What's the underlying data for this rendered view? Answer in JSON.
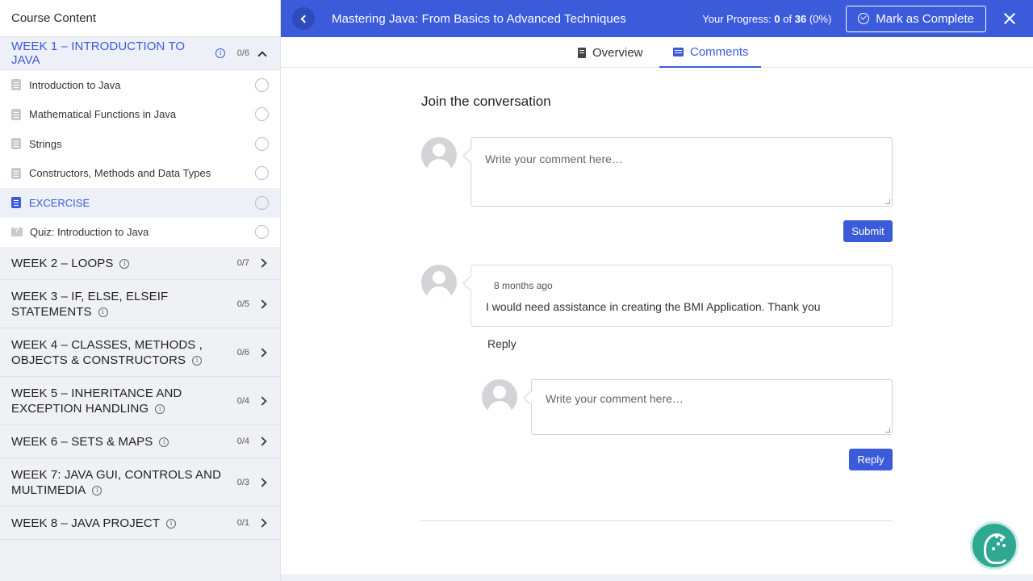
{
  "sidebar": {
    "header": "Course Content",
    "open_week": {
      "title": "WEEK 1 – INTRODUCTION TO JAVA",
      "count": "0/6",
      "lessons": [
        {
          "label": "Introduction to Java",
          "icon": "document-icon"
        },
        {
          "label": "Mathematical Functions in Java",
          "icon": "document-icon"
        },
        {
          "label": "Strings",
          "icon": "document-icon"
        },
        {
          "label": "Constructors, Methods and Data Types",
          "icon": "document-icon"
        },
        {
          "label": "EXCERCISE",
          "icon": "document-icon",
          "active": true
        },
        {
          "label": "Quiz: Introduction to Java",
          "icon": "quiz-icon"
        }
      ]
    },
    "weeks": [
      {
        "title_line1": "WEEK 2 – LOOPS",
        "title_line2": "",
        "count": "0/7"
      },
      {
        "title_line1": "WEEK 3 – IF, ELSE, ELSEIF",
        "title_line2": "STATEMENTS",
        "count": "0/5"
      },
      {
        "title_line1": "WEEK 4 – CLASSES, METHODS ,",
        "title_line2": "OBJECTS & CONSTRUCTORS",
        "count": "0/6"
      },
      {
        "title_line1": "WEEK 5 – INHERITANCE AND",
        "title_line2": "EXCEPTION HANDLING",
        "count": "0/4"
      },
      {
        "title_line1": "WEEK 6 – SETS & MAPS",
        "title_line2": "",
        "count": "0/4"
      },
      {
        "title_line1": "WEEK 7: JAVA GUI, CONTROLS AND",
        "title_line2": "MULTIMEDIA",
        "count": "0/3"
      },
      {
        "title_line1": "WEEK 8 – JAVA PROJECT",
        "title_line2": "",
        "count": "0/1"
      }
    ]
  },
  "topbar": {
    "course_title": "Mastering Java: From Basics to Advanced Techniques",
    "progress_label": "Your Progress:",
    "progress_done": "0",
    "progress_of": "of",
    "progress_total": "36",
    "progress_pct": "(0%)",
    "complete_label": "Mark as Complete"
  },
  "tabs": {
    "overview": "Overview",
    "comments": "Comments"
  },
  "comments": {
    "heading": "Join the conversation",
    "placeholder": "Write your comment here…",
    "submit_label": "Submit",
    "posted": {
      "time": "8 months ago",
      "text": "I would need assistance in creating the BMI Application. Thank you"
    },
    "reply_link": "Reply",
    "reply_placeholder": "Write your comment here…",
    "reply_button": "Reply"
  },
  "colors": {
    "accent": "#3b5bdb",
    "sidebar_bg": "#f0f1f5",
    "help_fab": "#2fa891"
  }
}
